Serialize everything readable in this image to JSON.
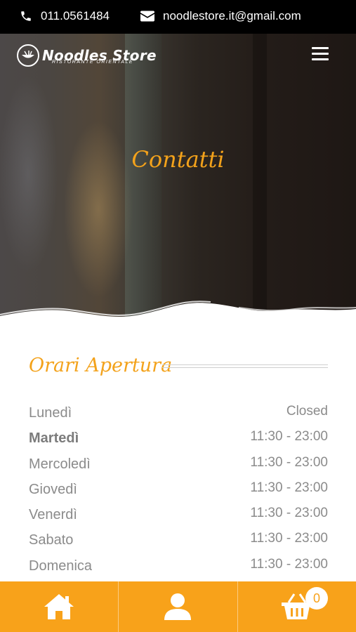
{
  "topbar": {
    "phone": "011.0561484",
    "email": "noodlestore.it@gmail.com",
    "phone_icon": "phone-icon",
    "email_icon": "envelope-icon"
  },
  "header": {
    "logo_name": "Noodles Store",
    "logo_subtitle": "RISTORANTE ORIENTALE",
    "menu_icon": "hamburger-menu-icon"
  },
  "hero": {
    "title": "Contatti"
  },
  "opening_hours": {
    "title": "Orari Apertura",
    "rows": [
      {
        "day": "Lunedì",
        "time": "Closed"
      },
      {
        "day": "Martedì",
        "time": "11:30 - 23:00"
      },
      {
        "day": "Mercoledì",
        "time": "11:30 - 23:00"
      },
      {
        "day": "Giovedì",
        "time": "11:30 - 23:00"
      },
      {
        "day": "Venerdì",
        "time": "11:30 - 23:00"
      },
      {
        "day": "Sabato",
        "time": "11:30 - 23:00"
      },
      {
        "day": "Domenica",
        "time": "11:30 - 23:00"
      }
    ]
  },
  "bottom_nav": {
    "items": [
      "home-icon",
      "user-icon",
      "basket-icon"
    ],
    "cart_count": "0"
  },
  "colors": {
    "accent": "#f3a21b",
    "bottom_bar": "#f8a21a",
    "topbar": "#000000"
  }
}
